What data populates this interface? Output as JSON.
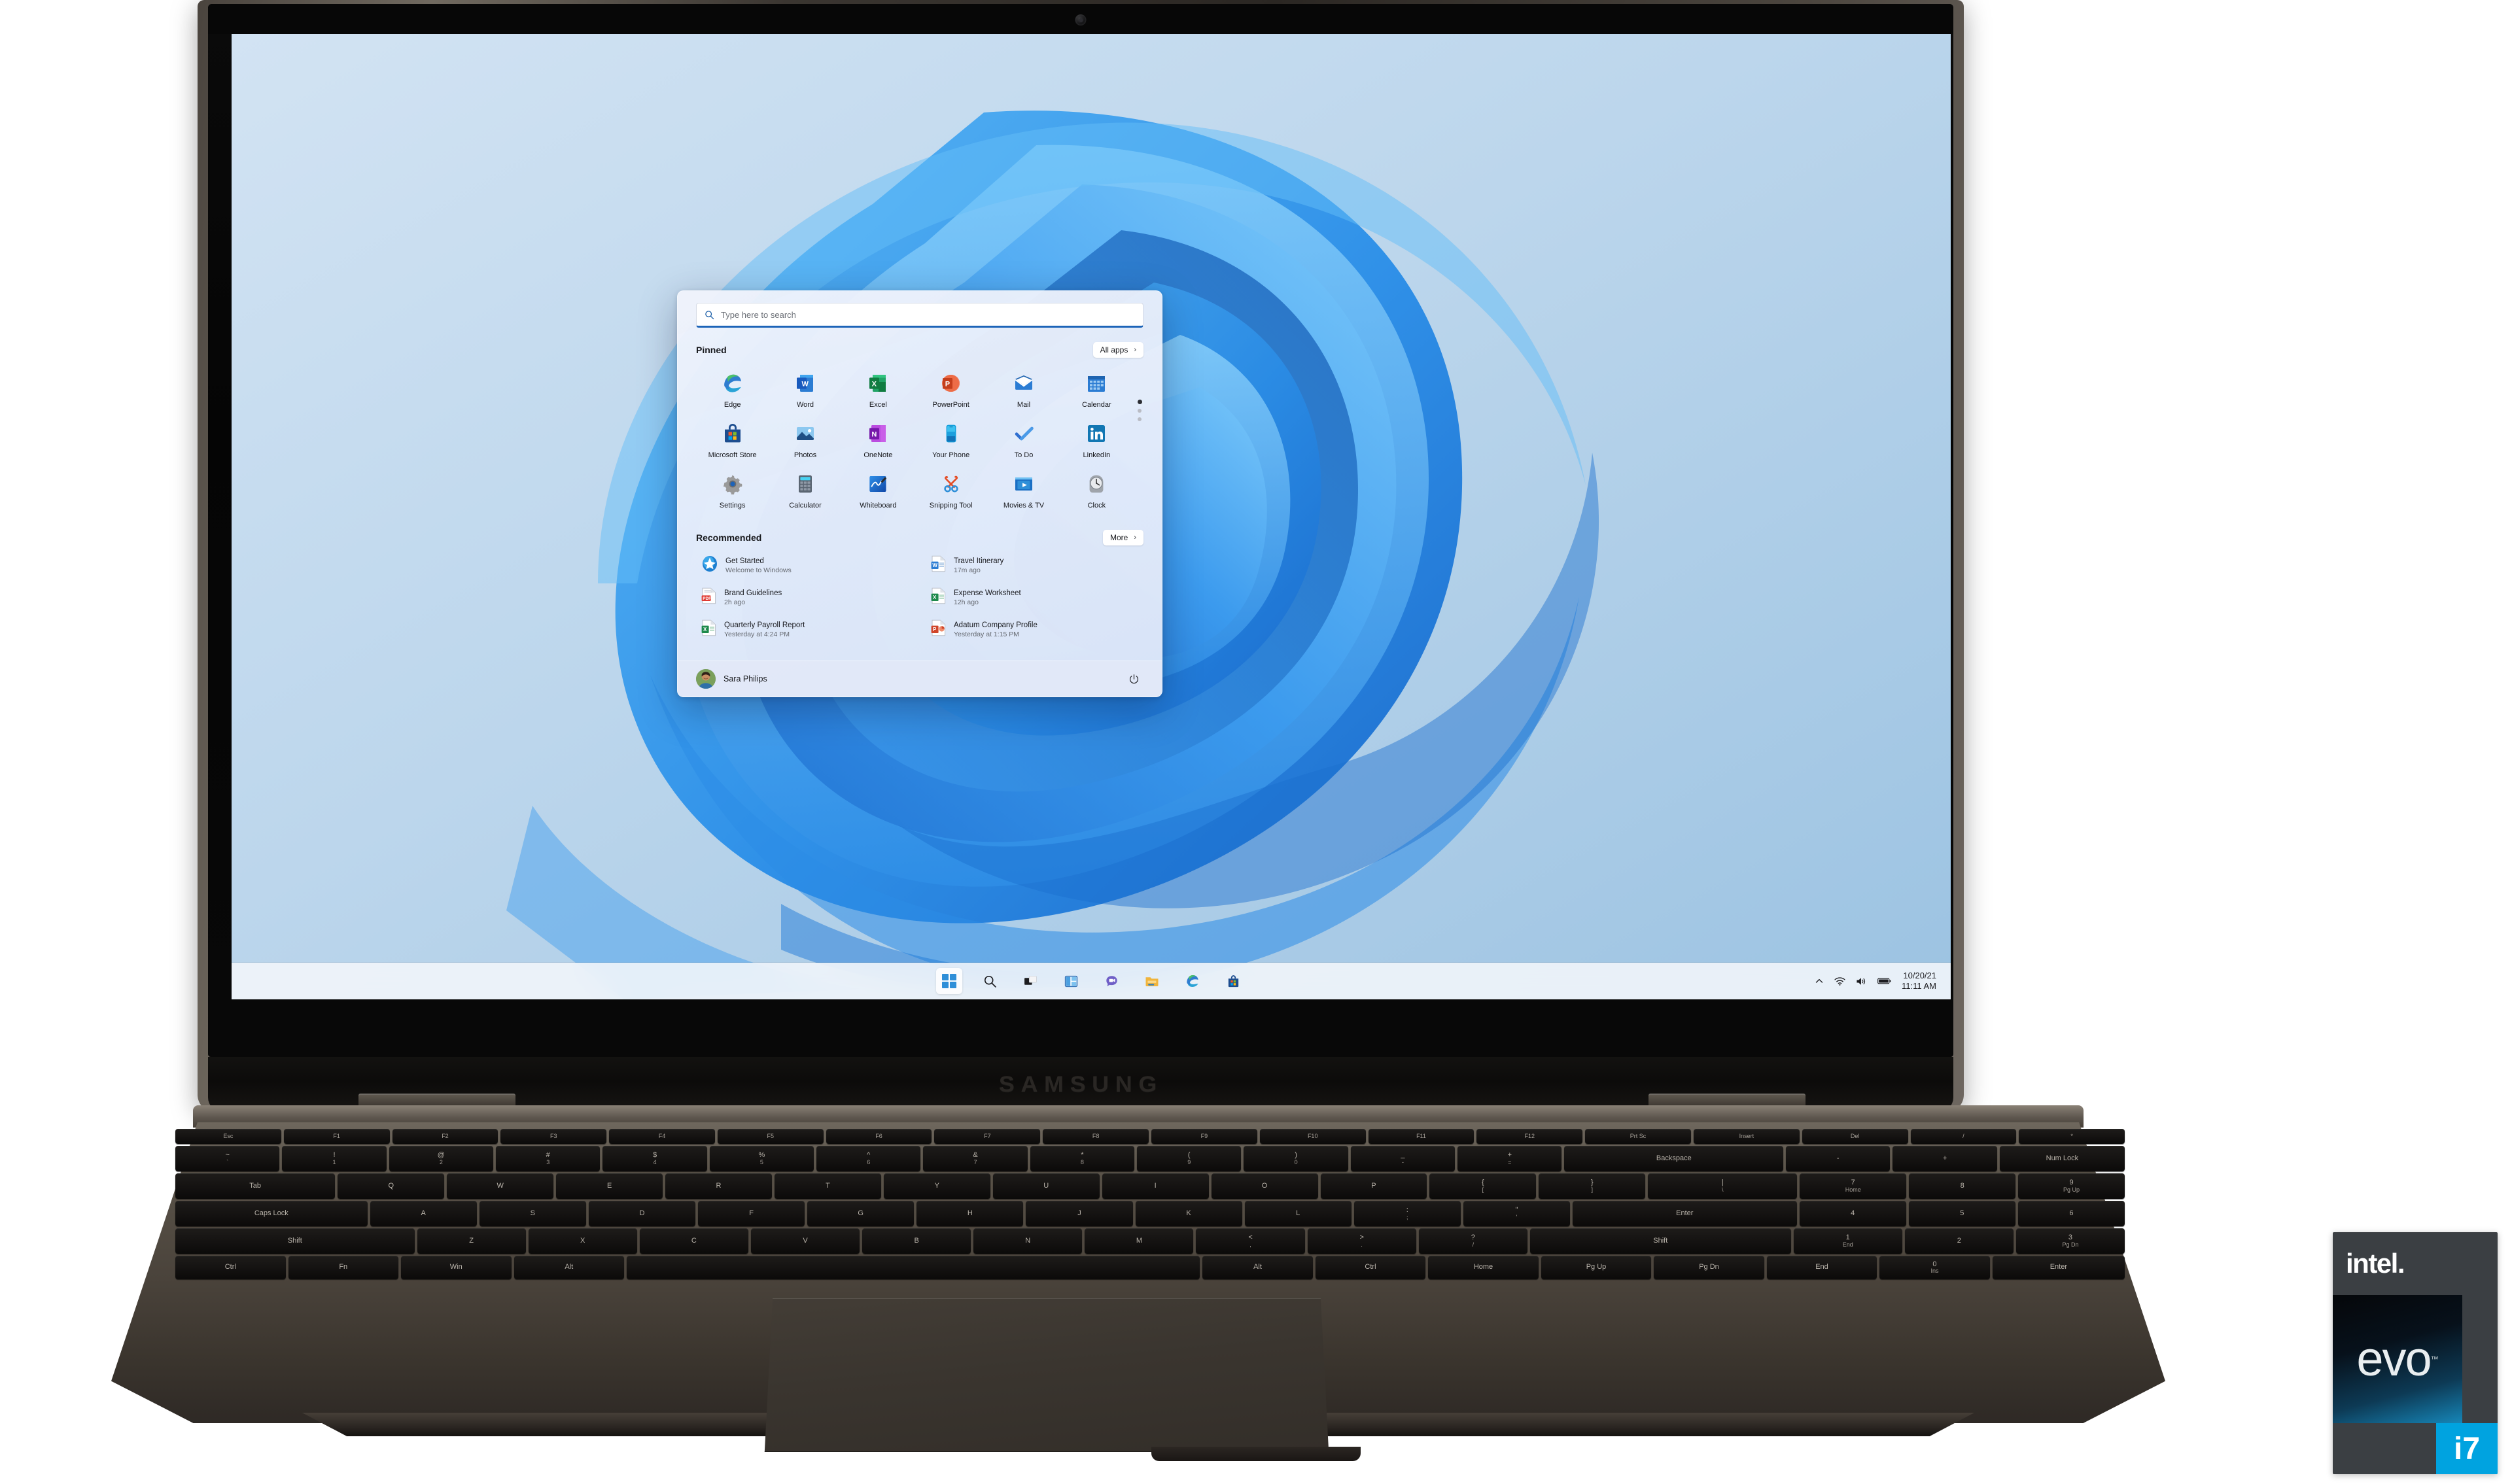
{
  "device": {
    "brand": "SAMSUNG"
  },
  "badge": {
    "vendor": "intel.",
    "product": "evo",
    "tm": "™",
    "tier": "i7"
  },
  "desktop": {
    "wallpaper_name": "windows-bloom-wallpaper"
  },
  "start_menu": {
    "search": {
      "placeholder": "Type here to search",
      "icon": "search-icon",
      "value": ""
    },
    "pinned": {
      "title": "Pinned",
      "all_apps_label": "All apps",
      "all_apps_chevron": "›",
      "page_dots": 3,
      "active_dot": 1,
      "apps": [
        {
          "label": "Edge",
          "icon": "edge-icon"
        },
        {
          "label": "Word",
          "icon": "word-icon"
        },
        {
          "label": "Excel",
          "icon": "excel-icon"
        },
        {
          "label": "PowerPoint",
          "icon": "powerpoint-icon"
        },
        {
          "label": "Mail",
          "icon": "mail-icon"
        },
        {
          "label": "Calendar",
          "icon": "calendar-icon"
        },
        {
          "label": "Microsoft Store",
          "icon": "microsoft-store-icon"
        },
        {
          "label": "Photos",
          "icon": "photos-icon"
        },
        {
          "label": "OneNote",
          "icon": "onenote-icon"
        },
        {
          "label": "Your Phone",
          "icon": "your-phone-icon"
        },
        {
          "label": "To Do",
          "icon": "to-do-icon"
        },
        {
          "label": "LinkedIn",
          "icon": "linkedin-icon"
        },
        {
          "label": "Settings",
          "icon": "settings-icon"
        },
        {
          "label": "Calculator",
          "icon": "calculator-icon"
        },
        {
          "label": "Whiteboard",
          "icon": "whiteboard-icon"
        },
        {
          "label": "Snipping Tool",
          "icon": "snipping-tool-icon"
        },
        {
          "label": "Movies & TV",
          "icon": "movies-tv-icon"
        },
        {
          "label": "Clock",
          "icon": "clock-icon"
        }
      ]
    },
    "recommended": {
      "title": "Recommended",
      "more_label": "More",
      "more_chevron": "›",
      "items": [
        {
          "name": "Get Started",
          "sub": "Welcome to Windows",
          "icon": "get-started-icon"
        },
        {
          "name": "Travel Itinerary",
          "sub": "17m ago",
          "icon": "word-doc-icon"
        },
        {
          "name": "Brand Guidelines",
          "sub": "2h ago",
          "icon": "pdf-doc-icon"
        },
        {
          "name": "Expense Worksheet",
          "sub": "12h ago",
          "icon": "excel-doc-icon"
        },
        {
          "name": "Quarterly Payroll Report",
          "sub": "Yesterday at 4:24 PM",
          "icon": "excel-doc-icon"
        },
        {
          "name": "Adatum Company Profile",
          "sub": "Yesterday at 1:15 PM",
          "icon": "powerpoint-doc-icon"
        }
      ]
    },
    "footer": {
      "user_name": "Sara Philips",
      "avatar": "user-avatar",
      "power_icon": "power-icon"
    }
  },
  "taskbar": {
    "items": [
      {
        "name": "start-button",
        "icon": "windows-logo-icon",
        "active": true
      },
      {
        "name": "search-button",
        "icon": "search-icon"
      },
      {
        "name": "task-view-button",
        "icon": "task-view-icon"
      },
      {
        "name": "widgets-button",
        "icon": "widgets-icon"
      },
      {
        "name": "chat-button",
        "icon": "chat-icon"
      },
      {
        "name": "file-explorer-button",
        "icon": "folder-icon"
      },
      {
        "name": "edge-button",
        "icon": "edge-icon"
      },
      {
        "name": "store-button",
        "icon": "microsoft-store-icon"
      }
    ],
    "tray": {
      "chevron_icon": "chevron-up-icon",
      "wifi_icon": "wifi-icon",
      "volume_icon": "volume-icon",
      "battery_icon": "battery-icon",
      "date": "10/20/21",
      "time": "11:11 AM"
    }
  },
  "keyboard": {
    "fn_row": [
      "Esc",
      "F1",
      "F2",
      "F3",
      "F4",
      "F5",
      "F6",
      "F7",
      "F8",
      "F9",
      "F10",
      "F11",
      "F12",
      "Prt Sc",
      "Insert",
      "Del",
      "/",
      "*"
    ],
    "num_row": [
      "~`",
      "!1",
      "@2",
      "#3",
      "$4",
      "%5",
      "^6",
      "&7",
      "*8",
      "(9",
      ")0",
      "_-",
      "+=",
      "Backspace",
      "-",
      "+",
      "Num Lock"
    ],
    "q_row": [
      "Tab",
      "Q",
      "W",
      "E",
      "R",
      "T",
      "Y",
      "U",
      "I",
      "O",
      "P",
      "{[",
      "}]",
      "|\\",
      "7 Home",
      "8",
      "9 Pg Up"
    ],
    "a_row": [
      "Caps Lock",
      "A",
      "S",
      "D",
      "F",
      "G",
      "H",
      "J",
      "K",
      "L",
      ":;",
      "\"'",
      "Enter",
      "4",
      "5",
      "6"
    ],
    "z_row": [
      "Shift",
      "Z",
      "X",
      "C",
      "V",
      "B",
      "N",
      "M",
      "<,",
      ">.",
      "?/",
      "Shift",
      "1 End",
      "2",
      "3 Pg Dn"
    ],
    "space_row": [
      "Ctrl",
      "Fn",
      "Win",
      "Alt",
      "",
      "Alt",
      "Ctrl",
      "Home",
      "Pg Up",
      "Pg Dn",
      "End",
      "0 Ins",
      "Enter"
    ]
  }
}
